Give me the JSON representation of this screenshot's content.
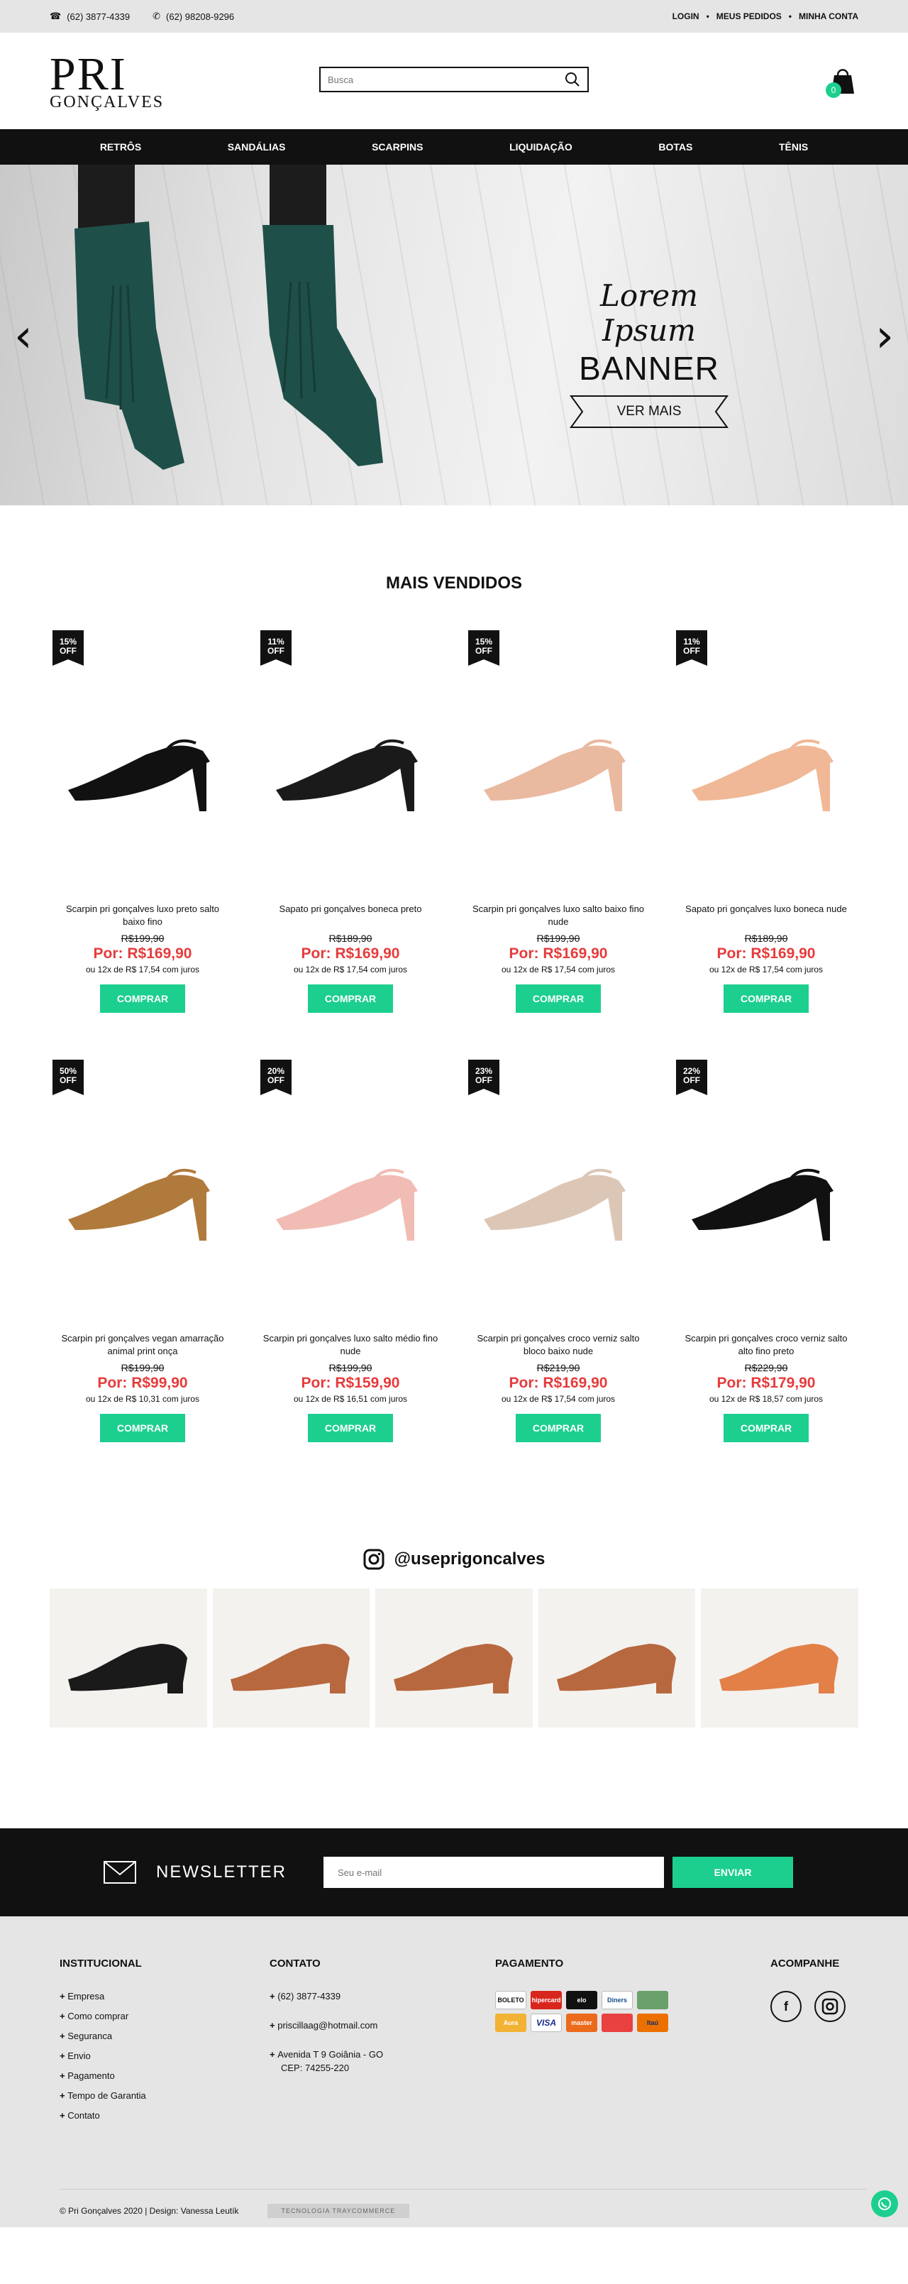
{
  "topbar": {
    "phone1": "(62) 3877-4339",
    "phone2": "(62) 98208-9296",
    "links": [
      "LOGIN",
      "MEUS PEDIDOS",
      "MINHA CONTA"
    ]
  },
  "header": {
    "logo_line1": "PRI",
    "logo_line2": "GONÇALVES",
    "search_placeholder": "Busca",
    "cart_count": "0"
  },
  "nav": [
    "RETRÔS",
    "SANDÁLIAS",
    "SCARPINS",
    "LIQUIDAÇÃO",
    "BOTAS",
    "TÊNIS"
  ],
  "hero": {
    "script": "Lorem Ipsum",
    "title": "BANNER",
    "button": "VER MAIS",
    "prev": "‹",
    "next": "›"
  },
  "section_title": "MAIS VENDIDOS",
  "products": [
    {
      "tag": "15%",
      "tag2": "OFF",
      "name": "Scarpin pri gonçalves luxo preto salto baixo fino",
      "old": "R$199,90",
      "now": "Por: R$169,90",
      "inst": "ou 12x de R$ 17,54 com juros",
      "buy": "COMPRAR",
      "color": "#111111"
    },
    {
      "tag": "11%",
      "tag2": "OFF",
      "name": "Sapato pri gonçalves boneca preto",
      "old": "R$189,90",
      "now": "Por: R$169,90",
      "inst": "ou 12x de R$ 17,54 com juros",
      "buy": "COMPRAR",
      "color": "#1a1a1a"
    },
    {
      "tag": "15%",
      "tag2": "OFF",
      "name": "Scarpin pri gonçalves luxo salto baixo fino nude",
      "old": "R$199,90",
      "now": "Por: R$169,90",
      "inst": "ou 12x de R$ 17,54 com juros",
      "buy": "COMPRAR",
      "color": "#e9b9a0"
    },
    {
      "tag": "11%",
      "tag2": "OFF",
      "name": "Sapato pri gonçalves luxo boneca nude",
      "old": "R$189,90",
      "now": "Por: R$169,90",
      "inst": "ou 12x de R$ 17,54 com juros",
      "buy": "COMPRAR",
      "color": "#f0b896"
    },
    {
      "tag": "50%",
      "tag2": "OFF",
      "name": "Scarpin pri gonçalves vegan amarração animal print onça",
      "old": "R$199,90",
      "now": "Por: R$99,90",
      "inst": "ou 12x de R$ 10,31 com juros",
      "buy": "COMPRAR",
      "color": "#b07a3c"
    },
    {
      "tag": "20%",
      "tag2": "OFF",
      "name": "Scarpin pri gonçalves luxo salto médio fino nude",
      "old": "R$199,90",
      "now": "Por: R$159,90",
      "inst": "ou 12x de R$ 16,51 com juros",
      "buy": "COMPRAR",
      "color": "#f1bcb4"
    },
    {
      "tag": "23%",
      "tag2": "OFF",
      "name": "Scarpin pri gonçalves croco verniz salto bloco baixo nude",
      "old": "R$219,90",
      "now": "Por: R$169,90",
      "inst": "ou 12x de R$ 17,54 com juros",
      "buy": "COMPRAR",
      "color": "#dcc6b5"
    },
    {
      "tag": "22%",
      "tag2": "OFF",
      "name": "Scarpin pri gonçalves croco verniz salto alto fino preto",
      "old": "R$229,90",
      "now": "Por: R$179,90",
      "inst": "ou 12x de R$ 18,57 com juros",
      "buy": "COMPRAR",
      "color": "#111111"
    }
  ],
  "instagram": {
    "handle": "@useprigoncalves",
    "colors": [
      "#1a1a1a",
      "#b8683e",
      "#b8683e",
      "#b8683e",
      "#e28048"
    ]
  },
  "newsletter": {
    "label": "NEWSLETTER",
    "placeholder": "Seu e-mail",
    "button": "ENVIAR"
  },
  "footer": {
    "inst_title": "INSTITUCIONAL",
    "inst_items": [
      "Empresa",
      "Como comprar",
      "Seguranca",
      "Envio",
      "Pagamento",
      "Tempo de Garantia",
      "Contato"
    ],
    "contact_title": "CONTATO",
    "contact_phone": "(62) 3877-4339",
    "contact_email": "priscillaag@hotmail.com",
    "contact_addr1": "Avenida T 9 Goiânia - GO",
    "contact_addr2": "CEP: 74255-220",
    "pay_title": "PAGAMENTO",
    "pay_items": [
      "BOLETO",
      "hipercard",
      "elo",
      "Diners",
      "",
      "Aura",
      "VISA",
      "master",
      "",
      "Itaú"
    ],
    "follow_title": "ACOMPANHE",
    "copyright": "© Pri Gonçalves 2020 | Design: Vanessa Leutík",
    "tech": "TECNOLOGIA TRAYCOMMERCE"
  },
  "accent": "#1ccf8f",
  "price_color": "#e63b3b"
}
